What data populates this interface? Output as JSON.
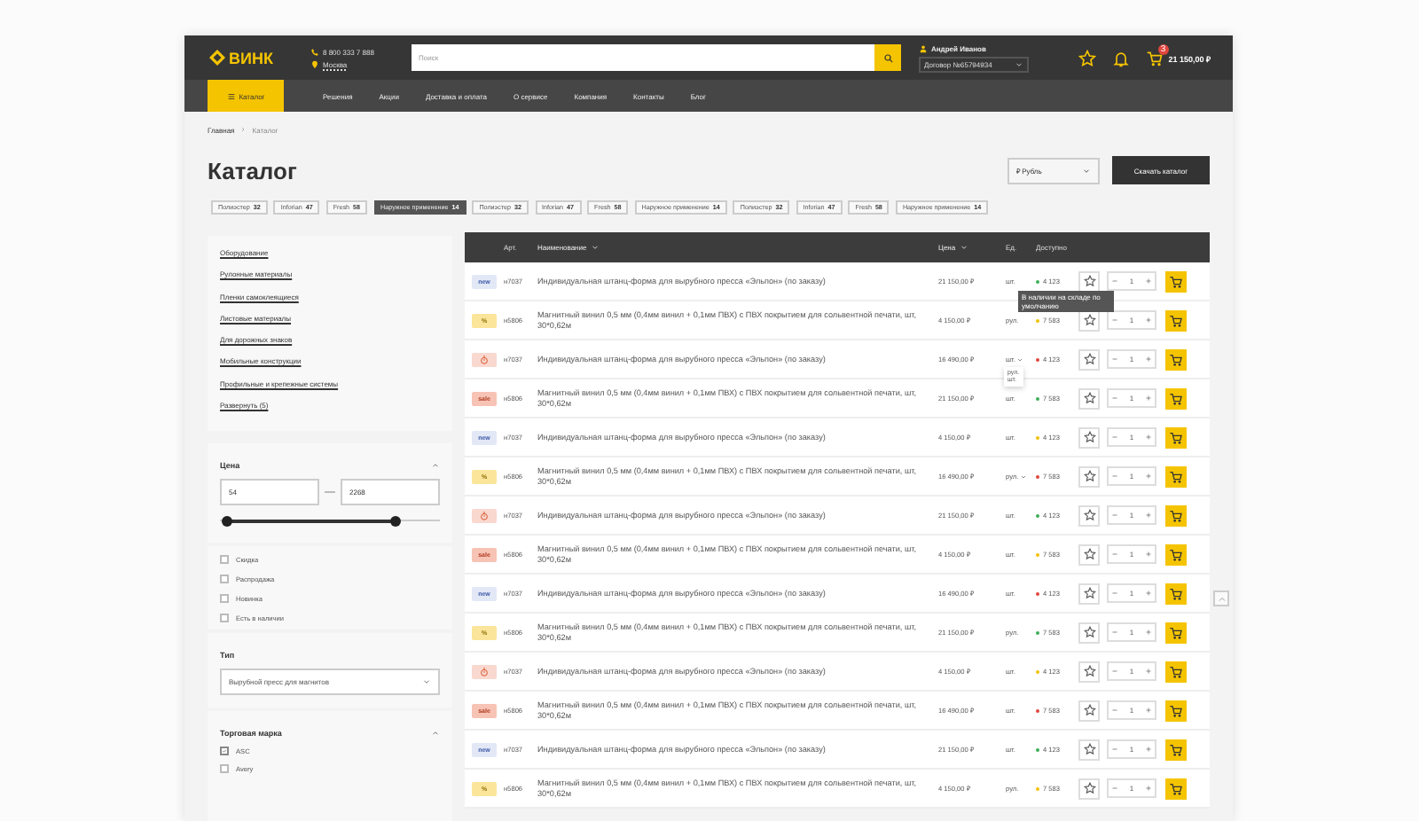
{
  "header": {
    "logo": "ВИНК",
    "phone": "8 800 333 7 888",
    "city": "Москва",
    "search": {
      "placeholder": "Поиск"
    },
    "user": "Андрей Иванов",
    "contract": "Договор №65794934",
    "cart_count": "3",
    "cart_total": "21 150,00 ₽"
  },
  "nav": {
    "catalog": "Каталог",
    "links": [
      "Решения",
      "Акции",
      "Доставка и оплата",
      "О сервисе",
      "Компания",
      "Контакты",
      "Блог"
    ]
  },
  "breadcrumbs": [
    "Главная",
    "Каталог"
  ],
  "title": "Каталог",
  "currency": "₽ Рубль",
  "download": "Скачать каталог",
  "tags": [
    {
      "label": "Полиэстер",
      "count": "32",
      "selected": false
    },
    {
      "label": "Inforian",
      "count": "47",
      "selected": false
    },
    {
      "label": "Fresh",
      "count": "58",
      "selected": false
    },
    {
      "label": "Наружное применение",
      "count": "14",
      "selected": true
    },
    {
      "label": "Полиэстер",
      "count": "32",
      "selected": false
    },
    {
      "label": "Inforian",
      "count": "47",
      "selected": false
    },
    {
      "label": "Fresh",
      "count": "58",
      "selected": false
    },
    {
      "label": "Наружное применение",
      "count": "14",
      "selected": false
    },
    {
      "label": "Полиэстер",
      "count": "32",
      "selected": false
    },
    {
      "label": "Inforian",
      "count": "47",
      "selected": false
    },
    {
      "label": "Fresh",
      "count": "58",
      "selected": false
    },
    {
      "label": "Наружное применение",
      "count": "14",
      "selected": false
    }
  ],
  "sidebar": {
    "categories": [
      "Оборудование",
      "Рулонные материалы",
      "Пленки самоклеящиеся",
      "Листовые материалы",
      "Для дорожных знаков",
      "Мобильные конструкции",
      "Профильные и крепежные системы"
    ],
    "expand": "Развернуть (5)",
    "price": {
      "title": "Цена",
      "expanded": true,
      "min": "54",
      "max": "2268",
      "thumbs": [
        {
          "level": 0.03
        },
        {
          "level": 0.8
        }
      ]
    },
    "flags": [
      {
        "label": "Скидка",
        "checked": false
      },
      {
        "label": "Распродажа",
        "checked": false
      },
      {
        "label": "Новинка",
        "checked": false
      },
      {
        "label": "Есть в наличии",
        "checked": false
      }
    ],
    "type": {
      "title": "Тип",
      "value": "Вырубной пресс для магнитов"
    },
    "brand": {
      "title": "Торговая марка",
      "expanded": true,
      "items": [
        {
          "label": "ASC",
          "checked": true
        },
        {
          "label": "Avery",
          "checked": false
        }
      ]
    }
  },
  "table": {
    "columns": [
      {
        "label": "Арт.",
        "sortable": false
      },
      {
        "label": "Наименование",
        "sortable": true
      },
      {
        "label": "Цена",
        "sortable": true
      },
      {
        "label": "Ед.",
        "sortable": false
      },
      {
        "label": "Доступно",
        "sortable": false
      }
    ],
    "rows": [
      {
        "badge": {
          "kind": "new",
          "text": "new"
        },
        "art": "н7037",
        "name": "Индивидуальная штанц-форма для вырубного пресса «Эльпон» (по заказу)",
        "price": "21 150,00 ₽",
        "unit": "шт.",
        "unit_menu": false,
        "stock": "4 123",
        "color": "#3fae5a",
        "qty": "1",
        "tooltip": "В наличии на складе по умолчанию"
      },
      {
        "badge": {
          "kind": "discount",
          "text": "%"
        },
        "art": "н5806",
        "name": "Магнитный винил 0,5 мм (0,4мм винил + 0,1мм ПВХ) с ПВХ покрытием для сольвентной печати, шт, 30*0,62м",
        "price": "4 150,00 ₽",
        "unit": "рул.",
        "unit_menu": false,
        "stock": "7 583",
        "color": "#f2c200",
        "qty": "1"
      },
      {
        "badge": {
          "kind": "timer"
        },
        "art": "н7037",
        "name": "Индивидуальная штанц-форма для вырубного пресса «Эльпон» (по заказу)",
        "price": "16 490,00 ₽",
        "unit": "шт.",
        "unit_menu": true,
        "unit_options": [
          "рул.",
          "шт."
        ],
        "stock": "4 123",
        "color": "#e0463d",
        "qty": "1"
      },
      {
        "badge": {
          "kind": "sale",
          "text": "sale"
        },
        "art": "н5806",
        "name": "Магнитный винил 0,5 мм (0,4мм винил + 0,1мм ПВХ) с ПВХ покрытием для сольвентной печати, шт, 30*0,62м",
        "price": "21 150,00 ₽",
        "unit": "шт.",
        "unit_menu": false,
        "stock": "7 583",
        "color": "#3fae5a",
        "qty": "1"
      },
      {
        "badge": {
          "kind": "new",
          "text": "new"
        },
        "art": "н7037",
        "name": "Индивидуальная штанц-форма для вырубного пресса «Эльпон» (по заказу)",
        "price": "4 150,00 ₽",
        "unit": "шт.",
        "unit_menu": false,
        "stock": "4 123",
        "color": "#f2c200",
        "qty": "1"
      },
      {
        "badge": {
          "kind": "discount",
          "text": "%"
        },
        "art": "н5806",
        "name": "Магнитный винил 0,5 мм (0,4мм винил + 0,1мм ПВХ) с ПВХ покрытием для сольвентной печати, шт, 30*0,62м",
        "price": "16 490,00 ₽",
        "unit": "рул.",
        "unit_menu": true,
        "stock": "7 583",
        "color": "#e0463d",
        "qty": "1"
      },
      {
        "badge": {
          "kind": "timer"
        },
        "art": "н7037",
        "name": "Индивидуальная штанц-форма для вырубного пресса «Эльпон» (по заказу)",
        "price": "21 150,00 ₽",
        "unit": "шт.",
        "unit_menu": false,
        "stock": "4 123",
        "color": "#3fae5a",
        "qty": "1"
      },
      {
        "badge": {
          "kind": "sale",
          "text": "sale"
        },
        "art": "н5806",
        "name": "Магнитный винил 0,5 мм (0,4мм винил + 0,1мм ПВХ) с ПВХ покрытием для сольвентной печати, шт, 30*0,62м",
        "price": "4 150,00 ₽",
        "unit": "шт.",
        "unit_menu": false,
        "stock": "7 583",
        "color": "#f2c200",
        "qty": "1"
      },
      {
        "badge": {
          "kind": "new",
          "text": "new"
        },
        "art": "н7037",
        "name": "Индивидуальная штанц-форма для вырубного пресса «Эльпон» (по заказу)",
        "price": "16 490,00 ₽",
        "unit": "шт.",
        "unit_menu": false,
        "stock": "4 123",
        "color": "#e0463d",
        "qty": "1"
      },
      {
        "badge": {
          "kind": "discount",
          "text": "%"
        },
        "art": "н5806",
        "name": "Магнитный винил 0,5 мм (0,4мм винил + 0,1мм ПВХ) с ПВХ покрытием для сольвентной печати, шт, 30*0,62м",
        "price": "21 150,00 ₽",
        "unit": "рул.",
        "unit_menu": false,
        "stock": "7 583",
        "color": "#3fae5a",
        "qty": "1"
      },
      {
        "badge": {
          "kind": "timer"
        },
        "art": "н7037",
        "name": "Индивидуальная штанц-форма для вырубного пресса «Эльпон» (по заказу)",
        "price": "4 150,00 ₽",
        "unit": "шт.",
        "unit_menu": false,
        "stock": "4 123",
        "color": "#f2c200",
        "qty": "1"
      },
      {
        "badge": {
          "kind": "sale",
          "text": "sale"
        },
        "art": "н5806",
        "name": "Магнитный винил 0,5 мм (0,4мм винил + 0,1мм ПВХ) с ПВХ покрытием для сольвентной печати, шт, 30*0,62м",
        "price": "16 490,00 ₽",
        "unit": "шт.",
        "unit_menu": false,
        "stock": "7 583",
        "color": "#e0463d",
        "qty": "1"
      },
      {
        "badge": {
          "kind": "new",
          "text": "new"
        },
        "art": "н7037",
        "name": "Индивидуальная штанц-форма для вырубного пресса «Эльпон» (по заказу)",
        "price": "21 150,00 ₽",
        "unit": "шт.",
        "unit_menu": false,
        "stock": "4 123",
        "color": "#3fae5a",
        "qty": "1"
      },
      {
        "badge": {
          "kind": "discount",
          "text": "%"
        },
        "art": "н5806",
        "name": "Магнитный винил 0,5 мм (0,4мм винил + 0,1мм ПВХ) с ПВХ покрытием для сольвентной печати, шт, 30*0,62м",
        "price": "4 150,00 ₽",
        "unit": "рул.",
        "unit_menu": false,
        "stock": "7 583",
        "color": "#f2c200",
        "qty": "1"
      }
    ]
  }
}
